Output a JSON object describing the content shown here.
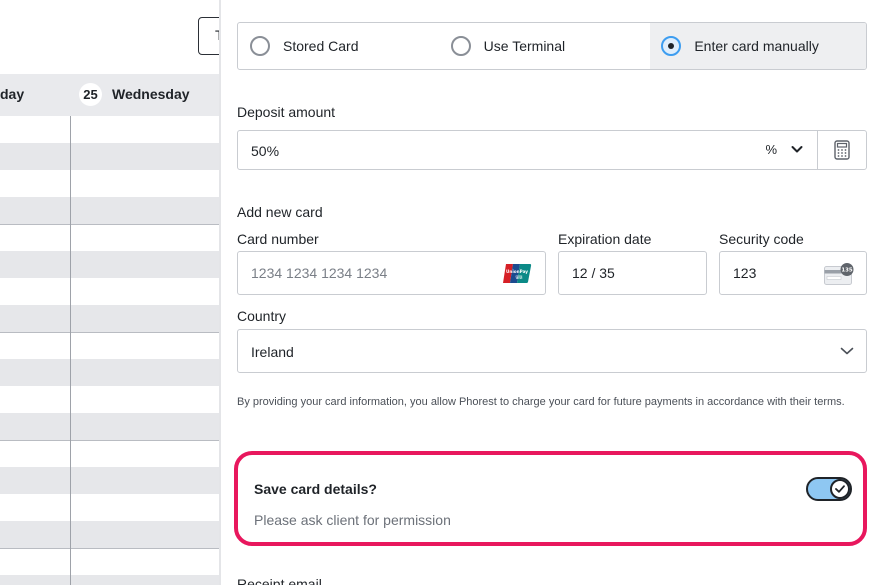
{
  "calendar": {
    "toolbar_button_label": "T",
    "prev_day_label": "day",
    "day_number": "25",
    "day_name": "Wednesday"
  },
  "payment": {
    "methods": [
      {
        "label": "Stored Card",
        "selected": false
      },
      {
        "label": "Use Terminal",
        "selected": false
      },
      {
        "label": "Enter card manually",
        "selected": true
      }
    ],
    "deposit": {
      "label": "Deposit amount",
      "value": "50%",
      "unit": "%"
    },
    "add_card": {
      "heading": "Add new card",
      "card_number_label": "Card number",
      "card_number_placeholder": "1234 1234 1234 1234",
      "expiration_label": "Expiration date",
      "expiration_value": "12 / 35",
      "security_label": "Security code",
      "security_value": "123",
      "cvc_hint": "135"
    },
    "country": {
      "label": "Country",
      "value": "Ireland"
    },
    "disclaimer": "By providing your card information, you allow Phorest to charge your card for future payments in accordance with their terms.",
    "save_card": {
      "title": "Save card details?",
      "subtitle": "Please ask client for permission",
      "enabled": true
    },
    "receipt_label": "Receipt email"
  },
  "colors": {
    "accent_blue": "#3d9df0",
    "toggle_fill": "#8ec7f2",
    "highlight_pink": "#e8175d",
    "calendar_shade": "#e6e7ea"
  }
}
